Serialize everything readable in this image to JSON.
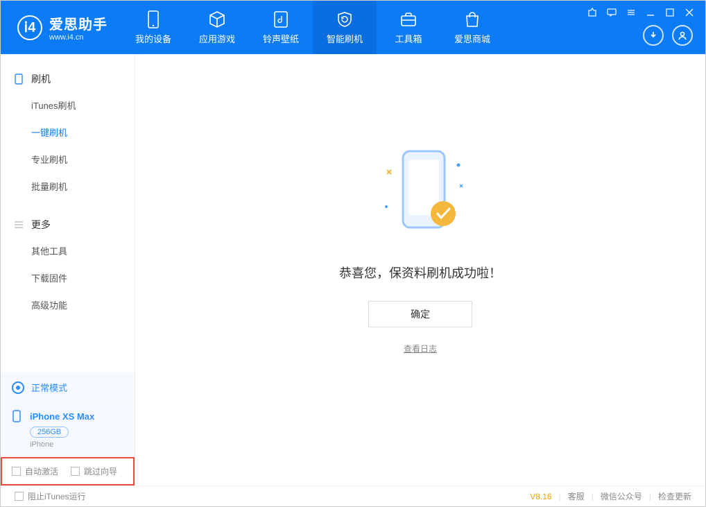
{
  "app": {
    "title": "爱思助手",
    "subtitle": "www.i4.cn"
  },
  "nav": {
    "tabs": [
      {
        "label": "我的设备"
      },
      {
        "label": "应用游戏"
      },
      {
        "label": "铃声壁纸"
      },
      {
        "label": "智能刷机"
      },
      {
        "label": "工具箱"
      },
      {
        "label": "爱思商城"
      }
    ]
  },
  "sidebar": {
    "group_flash": {
      "title": "刷机",
      "items": [
        "iTunes刷机",
        "一键刷机",
        "专业刷机",
        "批量刷机"
      ]
    },
    "group_more": {
      "title": "更多",
      "items": [
        "其他工具",
        "下载固件",
        "高级功能"
      ]
    },
    "status": {
      "label": "正常模式"
    },
    "device": {
      "name": "iPhone XS Max",
      "capacity": "256GB",
      "sub": "iPhone"
    },
    "checks": {
      "auto_activate": "自动激活",
      "skip_guide": "跳过向导"
    }
  },
  "main": {
    "success_text": "恭喜您，保资料刷机成功啦！",
    "ok_button": "确定",
    "view_log": "查看日志"
  },
  "footer": {
    "block_itunes": "阻止iTunes运行",
    "version": "V8.16",
    "links": [
      "客服",
      "微信公众号",
      "检查更新"
    ]
  }
}
